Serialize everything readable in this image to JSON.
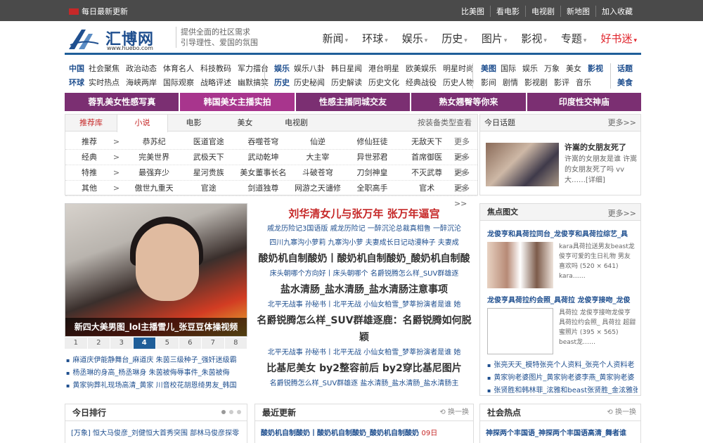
{
  "topbar": {
    "daily": "每日最新更新",
    "links": [
      "比美图",
      "看电影",
      "电视剧",
      "新地图",
      "加入收藏"
    ]
  },
  "header": {
    "logo_cn": "汇博网",
    "logo_url": "www.huebo.com",
    "slogan_line1": "提供全面的社区需求",
    "slogan_line2": "引导理性、爱国的氛围",
    "nav": [
      "新闻",
      "环球",
      "娱乐",
      "历史",
      "图片",
      "影视",
      "专题",
      "好书迷"
    ]
  },
  "categories": {
    "g1": {
      "row1_head": "中国",
      "row1": [
        "社会聚焦",
        "政治动态",
        "体育名人",
        "科技教码",
        "军力擂台"
      ],
      "row2_head": "环球",
      "row2": [
        "实时热点",
        "海峡两岸",
        "国际观察",
        "战略评述",
        "幽默搞笑"
      ]
    },
    "g2": {
      "row1_head": "娱乐",
      "row1": [
        "娱乐八卦",
        "韩日星闻",
        "港台明星",
        "欧美娱乐",
        "明星时尚"
      ],
      "row2_head": "历史",
      "row2": [
        "历史秘闻",
        "历史解读",
        "历史文化",
        "经典战役",
        "历史人物"
      ]
    },
    "g3": {
      "row1_head": "美图",
      "row1": [
        "国际",
        "娱乐",
        "万象",
        "美女",
        "影视"
      ],
      "row2_head": "",
      "row2": [
        "影间",
        "剧情",
        "影视剧",
        "影评",
        "音乐"
      ]
    },
    "g4": {
      "row1_head": "话题",
      "row2_head": "美食"
    }
  },
  "purplebar": [
    "蓉乳美女性感写真",
    "韩国美女主播实拍",
    "性感主播同城交友",
    "熟女翘臀等你来",
    "印度性交神庙"
  ],
  "tabs": {
    "items": [
      "推荐库",
      "小说",
      "电影",
      "美女",
      "电视剧"
    ],
    "tip": "按装备类型查看"
  },
  "rank_rows": [
    {
      "label": "推荐",
      "items": [
        "恭苏纪",
        "医道官途",
        "吞噬苍穹",
        "仙逆",
        "修仙狂徒",
        "无敌天下"
      ],
      "more": "更多>>"
    },
    {
      "label": "经典",
      "items": [
        "完美世界",
        "武极天下",
        "武动乾坤",
        "大主宰",
        "异世邪君",
        "首席御医"
      ],
      "more": "更多>>"
    },
    {
      "label": "特推",
      "items": [
        "最强弃少",
        "星河贵族",
        "美女董事长名",
        "斗破苍穹",
        "刀剑神皇",
        "不灭武尊"
      ],
      "more": "更多>>"
    },
    {
      "label": "其他",
      "items": [
        "傲世九重天",
        "官途",
        "剑道独尊",
        "网游之天谴修",
        "全职高手",
        "官术"
      ],
      "more": "更多>>"
    }
  ],
  "today_topic": {
    "title": "今日话题",
    "more": "更多>>",
    "headline": "许嵩的女朋友死了",
    "desc": "许嵩的女朋友是谁 许嵩的女朋友死了吗 vv大……[详细]"
  },
  "bigpic": {
    "caption": "新四大美男图_lol主播雪儿_张豆豆体操视频",
    "pages": [
      "1",
      "2",
      "3",
      "4",
      "5",
      "6",
      "7",
      "8"
    ],
    "active_page": "4"
  },
  "left_list": [
    "麻道庆伊能静舞台_麻道庆   朱茵三级种子_强奸迷级霸",
    "杨丞琳的身高_杨丞琳身   朱茵被侮辱事件_朱茵被侮",
    "黄家驹葬礼现场高清_黄家   川音校花胡恩绮男友_韩国"
  ],
  "center": {
    "headline1": "刘华清女儿与张万年 张万年逼宫",
    "sub1a": "戚龙历险记3国语版 戚龙历险记  一醉沉沦总裁真相鲁  一醉沉沦",
    "sub1b": "四川九寨沟小萝莉 九寨沟小萝   夫妻成长日记动漫种子 夫妻成",
    "headline2": "酸奶机自制酸奶丨酸奶机自制酸奶_酸奶机自制酸",
    "sub2": "床头朝哪个方向好丨床头朝哪个   名爵锐腾怎么样_SUV群雄逐",
    "headline3": "盐水清肠_盐水清肠_盐水清肠注意事项",
    "sub3": "北平无战事 孙秘书丨北平无战   小仙女柏雪_梦莘扮演者是谁 她",
    "headline4": "名爵锐腾怎么样_SUV群雄逐鹿：名爵锐腾如何脱颖",
    "sub4": "北平无战事 孙秘书丨北平无战   小仙女柏雪_梦莘扮演者是谁 她",
    "headline5": "比基尼美女 by2整容前后 by2穿比基尼图片",
    "sub5": "名爵锐腾怎么样_SUV群雄逐   盐水清肠_盐水清肠_盐水清肠主"
  },
  "focus": {
    "title": "焦点图文",
    "more": "更多>>",
    "item1_title": "龙俊亨和具荷拉同台_龙俊亨和具荷拉综艺_具",
    "item1_desc": "kara具荷拉送男友beast龙俊亨可爱的生日礼物 男友喜欢吗 (520 × 641) kara……",
    "item2_title": "龙俊亨具荷拉约会照_具荷拉 龙俊亨接吻_龙俊",
    "item2_desc": "具荷拉 龙俊亨接吻龙俊亨具荷拉约会照_ 具荷拉 超甜蜜照片 (395 × 565) beast龙……",
    "links": [
      "张亮天天_模特张亮个人资料_张亮个人资料老",
      "黄家驹老婆图片_黄家驹老婆李燕_黄家驹老婆",
      "张贤胜和韩林菲_泫雅和beast张贤胜_金泫雅张"
    ]
  },
  "bottom": {
    "rank_title": "今日排行",
    "rank_row": "[万象] 恒大马俊彦_刘健恒大首秀突围 部林马俊彦探零",
    "latest_title": "最近更新",
    "latest_row": "酸奶机自制酸奶丨酸奶机自制酸奶_酸奶机自制酸奶",
    "latest_date": "09日",
    "social_title": "社会热点",
    "social_row": "神探两个丰国语_神探两个丰国语高清_舞者谁",
    "switch": "换一换"
  },
  "colors": {
    "accent_blue": "#1f5e99",
    "purple": "#7b2f72",
    "red": "#c62828"
  }
}
